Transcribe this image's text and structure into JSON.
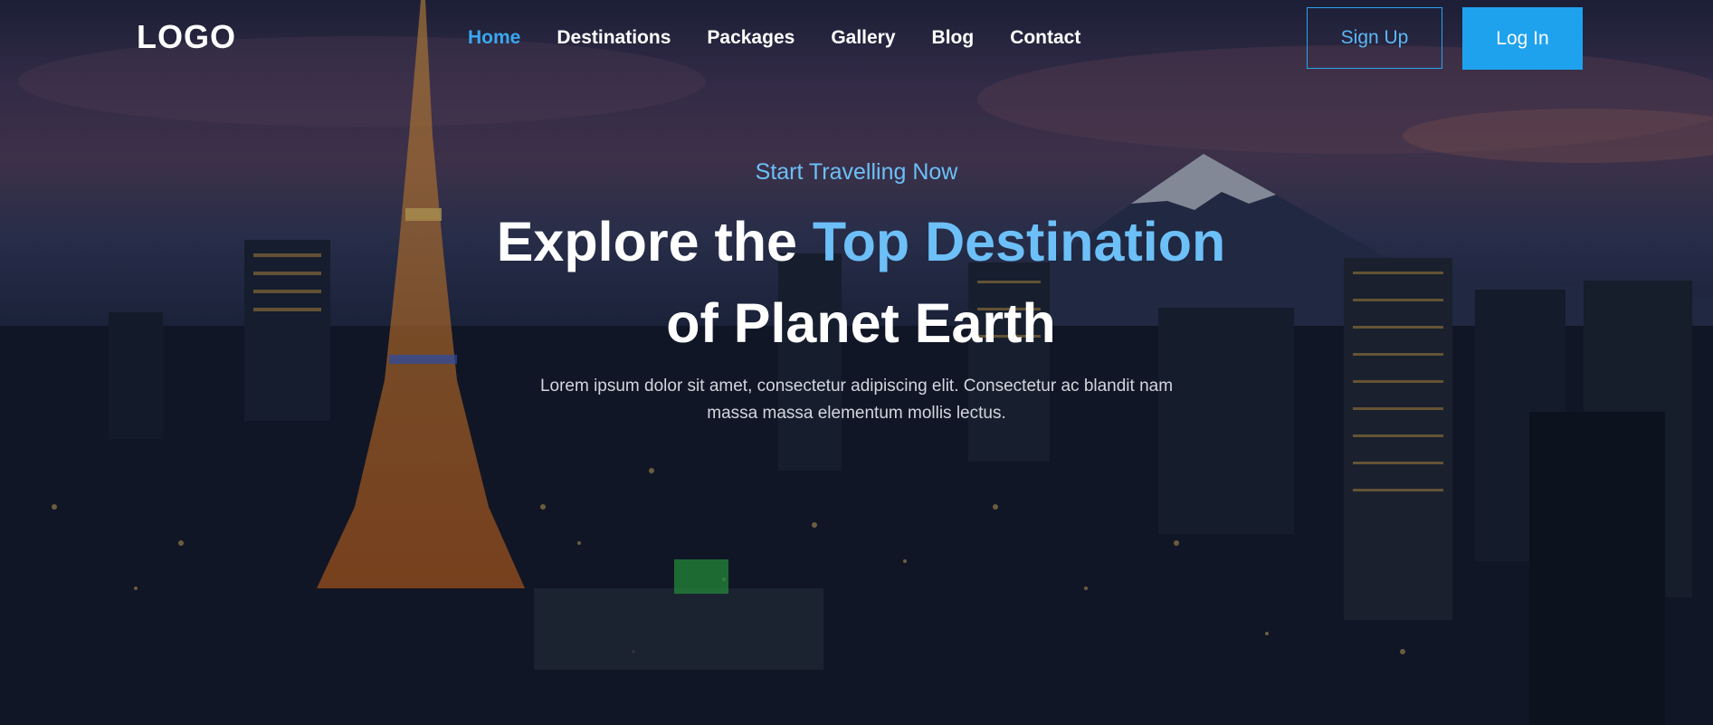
{
  "brand": {
    "logo_text": "LOGO"
  },
  "nav": {
    "items": [
      {
        "label": "Home",
        "active": true
      },
      {
        "label": "Destinations",
        "active": false
      },
      {
        "label": "Packages",
        "active": false
      },
      {
        "label": "Gallery",
        "active": false
      },
      {
        "label": "Blog",
        "active": false
      },
      {
        "label": "Contact",
        "active": false
      }
    ]
  },
  "auth": {
    "signup_label": "Sign Up",
    "login_label": "Log In"
  },
  "hero": {
    "eyebrow": "Start Travelling Now",
    "headline_part1": "Explore the ",
    "headline_accent": "Top Destination",
    "headline_line2": "of Planet Earth",
    "subtext": "Lorem ipsum dolor sit amet, consectetur adipiscing elit. Consectetur ac blandit nam massa massa elementum mollis lectus."
  },
  "colors": {
    "accent": "#1fa2ee",
    "accent_light": "#6cc0f7",
    "nav_active": "#3aa8f0",
    "text": "#ffffff"
  },
  "background": {
    "image": "night-city-skyline-with-tower-and-mountain"
  }
}
